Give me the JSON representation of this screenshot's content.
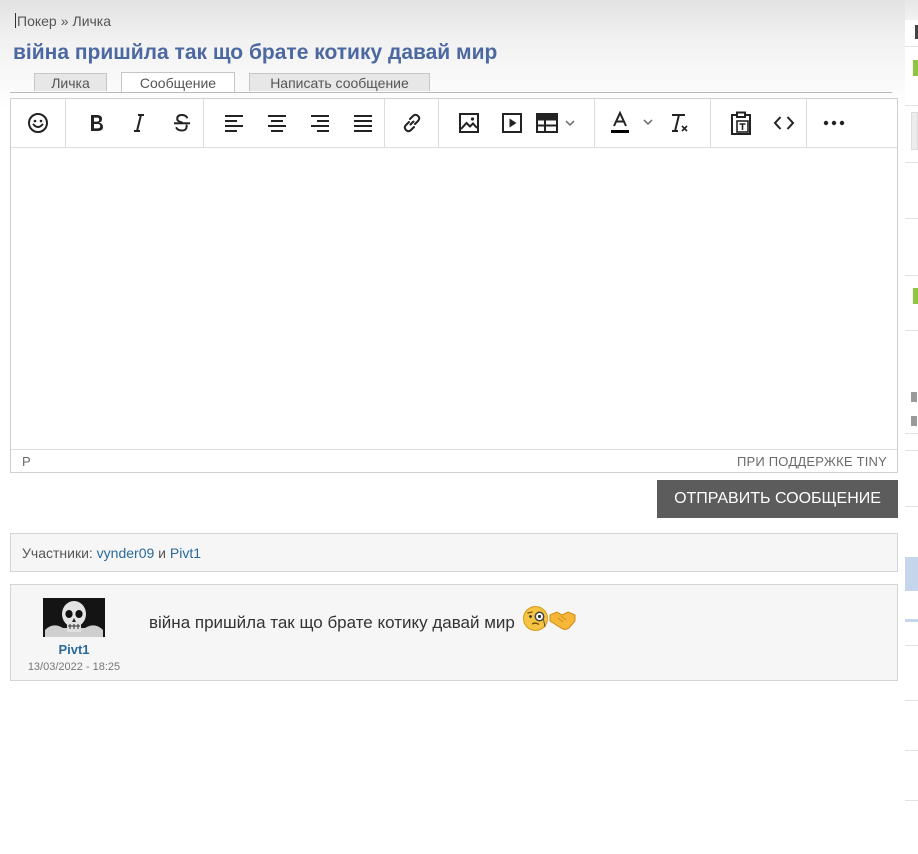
{
  "breadcrumb": {
    "parent": "Покер",
    "separator": "»",
    "current": "Личка"
  },
  "page_title": "війна пришйла так що брате котику давай мир",
  "tabs": [
    {
      "label": "Личка",
      "active": false
    },
    {
      "label": "Сообщение",
      "active": true
    },
    {
      "label": "Написать сообщение",
      "active": false
    }
  ],
  "editor": {
    "toolbar_icons": [
      "emoticons-icon",
      "bold-icon",
      "italic-icon",
      "strikethrough-icon",
      "align-left-icon",
      "align-center-icon",
      "align-right-icon",
      "align-justify-icon",
      "link-icon",
      "image-icon",
      "media-icon",
      "table-icon",
      "text-color-icon",
      "clear-formatting-icon",
      "paste-as-text-icon",
      "source-code-icon",
      "more-icon"
    ],
    "status_path": "P",
    "branding": "ПРИ ПОДДЕРЖКЕ TINY"
  },
  "send_button": "ОТПРАВИТЬ СООБЩЕНИЕ",
  "participants": {
    "label": "Участники:",
    "user1": "vynder09",
    "conjunction": "и",
    "user2": "Pivt1"
  },
  "message": {
    "author": "Pivt1",
    "date": "13/03/2022 - 18:25",
    "text": "війна пришйла так що брате котику давай мир"
  },
  "colors": {
    "title": "#4b68a0",
    "link": "#2a6a9a",
    "button_bg": "#5c5c5c"
  }
}
